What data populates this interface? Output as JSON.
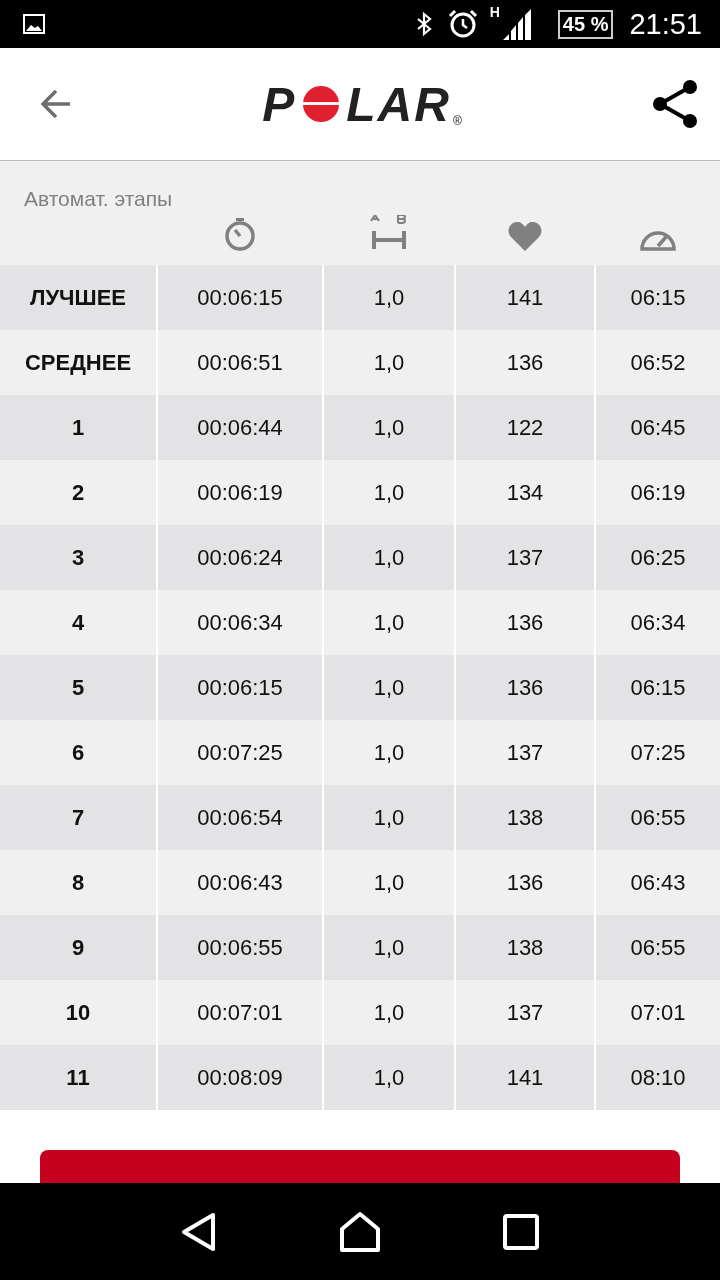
{
  "status_bar": {
    "network_type": "H",
    "battery": "45 %",
    "time": "21:51"
  },
  "header": {
    "logo": {
      "before": "P",
      "after": "LAR",
      "mark": "®"
    }
  },
  "section_title": "Автомат. этапы",
  "table": {
    "rows": [
      {
        "label": "ЛУЧШЕЕ",
        "time": "00:06:15",
        "distance": "1,0",
        "heart_rate": "141",
        "pace": "06:15"
      },
      {
        "label": "СРЕДНЕЕ",
        "time": "00:06:51",
        "distance": "1,0",
        "heart_rate": "136",
        "pace": "06:52"
      },
      {
        "label": "1",
        "time": "00:06:44",
        "distance": "1,0",
        "heart_rate": "122",
        "pace": "06:45"
      },
      {
        "label": "2",
        "time": "00:06:19",
        "distance": "1,0",
        "heart_rate": "134",
        "pace": "06:19"
      },
      {
        "label": "3",
        "time": "00:06:24",
        "distance": "1,0",
        "heart_rate": "137",
        "pace": "06:25"
      },
      {
        "label": "4",
        "time": "00:06:34",
        "distance": "1,0",
        "heart_rate": "136",
        "pace": "06:34"
      },
      {
        "label": "5",
        "time": "00:06:15",
        "distance": "1,0",
        "heart_rate": "136",
        "pace": "06:15"
      },
      {
        "label": "6",
        "time": "00:07:25",
        "distance": "1,0",
        "heart_rate": "137",
        "pace": "07:25"
      },
      {
        "label": "7",
        "time": "00:06:54",
        "distance": "1,0",
        "heart_rate": "138",
        "pace": "06:55"
      },
      {
        "label": "8",
        "time": "00:06:43",
        "distance": "1,0",
        "heart_rate": "136",
        "pace": "06:43"
      },
      {
        "label": "9",
        "time": "00:06:55",
        "distance": "1,0",
        "heart_rate": "138",
        "pace": "06:55"
      },
      {
        "label": "10",
        "time": "00:07:01",
        "distance": "1,0",
        "heart_rate": "137",
        "pace": "07:01"
      },
      {
        "label": "11",
        "time": "00:08:09",
        "distance": "1,0",
        "heart_rate": "141",
        "pace": "08:10"
      }
    ]
  }
}
